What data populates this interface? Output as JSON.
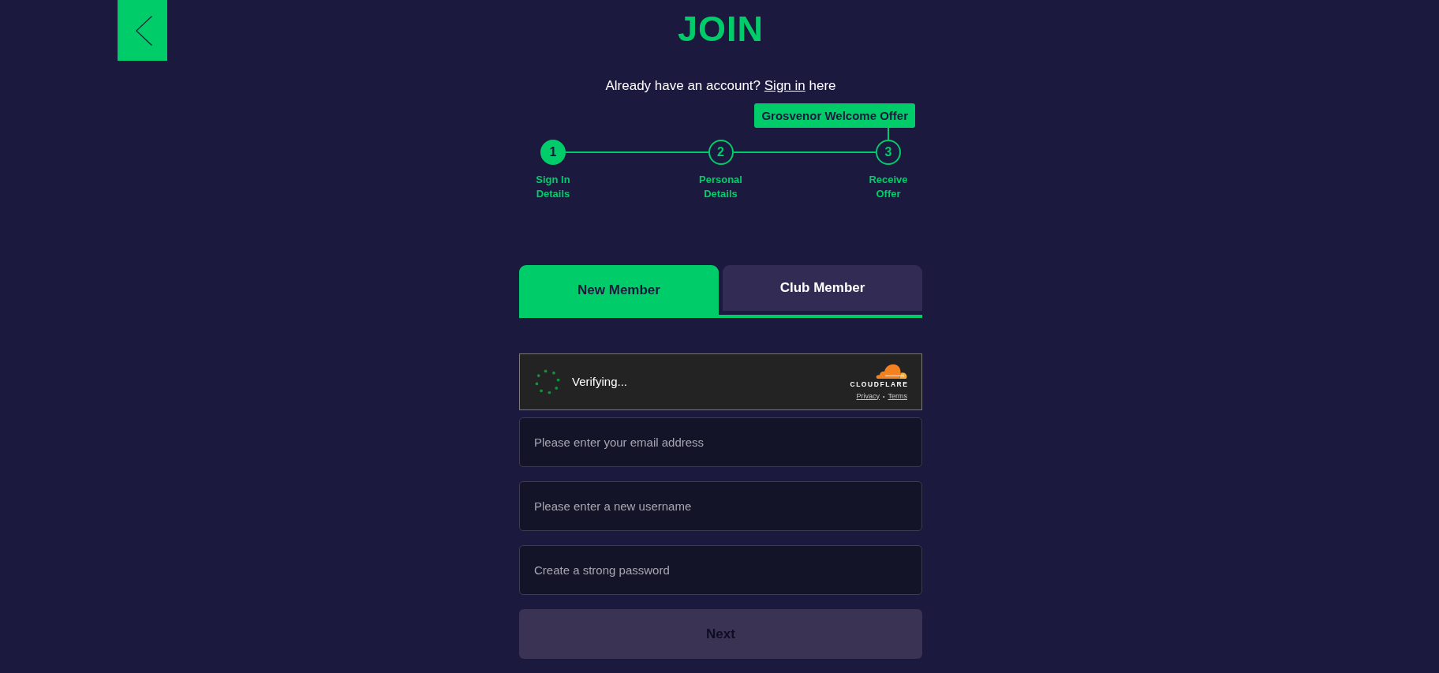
{
  "title": "JOIN",
  "signin_prompt": {
    "text": "Already have an account?",
    "link": "Sign in",
    "suffix": "here"
  },
  "stepper": {
    "steps": [
      {
        "number": "1",
        "label": "Sign In Details",
        "selected": true
      },
      {
        "number": "2",
        "label": "Personal Details",
        "selected": false
      },
      {
        "number": "3",
        "label": "Receive Offer",
        "selected": false,
        "badge": "Grosvenor Welcome Offer"
      }
    ]
  },
  "tabs": [
    {
      "label": "New Member",
      "selected": true
    },
    {
      "label": "Club Member",
      "selected": false
    }
  ],
  "captcha": {
    "status": "Verifying...",
    "brand": "CLOUDFLARE",
    "links": [
      "Privacy",
      "Terms"
    ],
    "separator": "•"
  },
  "fields": [
    {
      "placeholder": "Please enter your email address"
    },
    {
      "placeholder": "Please enter a new username"
    },
    {
      "placeholder": "Create a strong password"
    }
  ],
  "next_button": {
    "label": "Next",
    "disabled": true
  }
}
